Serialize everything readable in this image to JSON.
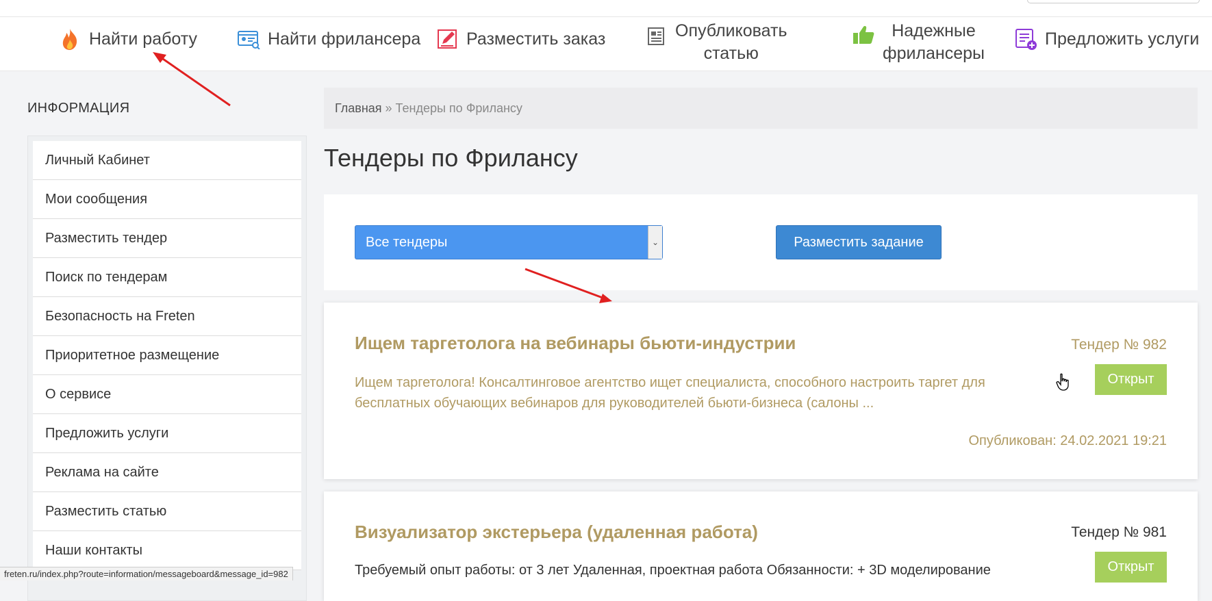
{
  "nav": {
    "items": [
      {
        "label": "Найти работу",
        "icon": "fire-icon"
      },
      {
        "label": "Найти фрилансера",
        "icon": "freelancer-card-icon"
      },
      {
        "label": "Разместить заказ",
        "icon": "edit-order-icon"
      },
      {
        "label_lines": [
          "Опубликовать",
          "статью"
        ],
        "icon": "newspaper-icon"
      },
      {
        "label_lines": [
          "Надежные",
          "фрилансеры"
        ],
        "icon": "thumbs-up-icon"
      },
      {
        "label": "Предложить услуги",
        "icon": "services-list-icon"
      }
    ]
  },
  "sidebar": {
    "title": "ИНФОРМАЦИЯ",
    "items": [
      {
        "label": "Личный Кабинет"
      },
      {
        "label": "Мои сообщения"
      },
      {
        "label": "Разместить тендер"
      },
      {
        "label": "Поиск по тендерам"
      },
      {
        "label": "Безопасность на Freten"
      },
      {
        "label": "Приоритетное размещение"
      },
      {
        "label": "О сервисе"
      },
      {
        "label": "Предложить услуги"
      },
      {
        "label": "Реклама на сайте"
      },
      {
        "label": "Разместить статью"
      },
      {
        "label": "Наши контакты"
      }
    ]
  },
  "breadcrumb": {
    "home": "Главная",
    "separator": " » ",
    "current": "Тендеры по Фрилансу"
  },
  "page": {
    "title": "Тендеры по Фрилансу"
  },
  "filter": {
    "select_value": "Все тендеры",
    "post_button": "Разместить задание"
  },
  "tenders": [
    {
      "title": "Ищем таргетолога на вебинары бьюти-индустрии",
      "number": "Тендер № 982",
      "status": "Открыт",
      "description": "Ищем таргетолога! Консалтинговое агентство ищет специалиста, способного настроить таргет для бесплатных обучающих вебинаров для руководителей бьюти-бизнеса (салоны ...",
      "published": "Опубликован: 24.02.2021 19:21",
      "color": "#b09a62"
    },
    {
      "title": "Визуализатор экстерьера (удаленная работа)",
      "number": "Тендер № 981",
      "status": "Открыт",
      "description": "Требуемый опыт работы: от 3 лет Удаленная, проектная работа Обязанности: + 3D моделирование",
      "color": "#333333"
    }
  ],
  "status_bar": {
    "url": "freten.ru/index.php?route=information/messageboard&message_id=982"
  },
  "colors": {
    "accent_gold": "#b09a62",
    "open_badge": "#a6cf5c",
    "select_blue": "#4b96f0",
    "button_blue": "#3d89d3",
    "annotation_arrow": "#e02020"
  }
}
